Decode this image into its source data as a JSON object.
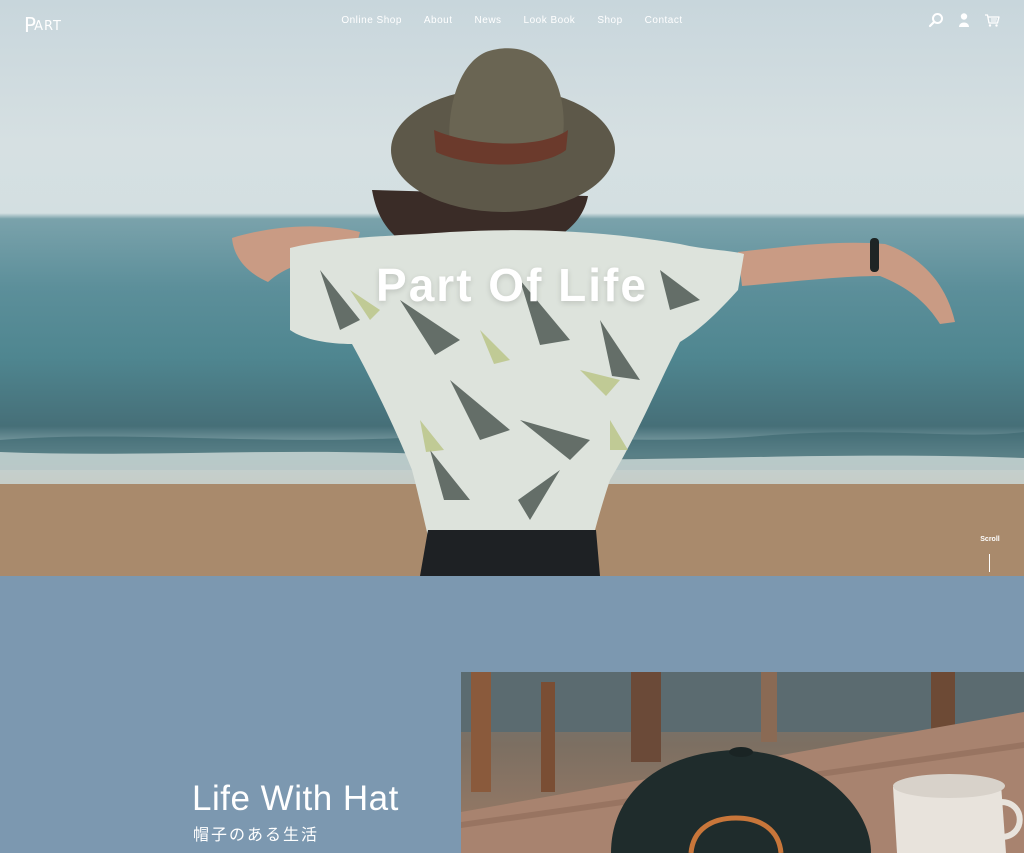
{
  "brand": {
    "logo_initial": "P",
    "logo_rest": "ART"
  },
  "nav": {
    "items": [
      {
        "label": "Online Shop"
      },
      {
        "label": "About"
      },
      {
        "label": "News"
      },
      {
        "label": "Look Book"
      },
      {
        "label": "Shop"
      },
      {
        "label": "Contact"
      }
    ],
    "icons": [
      "search-icon",
      "user-icon",
      "cart-icon"
    ]
  },
  "hero": {
    "title": "Part Of Life",
    "scroll_label": "Scroll"
  },
  "section": {
    "title": "Life With Hat",
    "subtitle": "帽子のある生活"
  },
  "colors": {
    "section_bg": "#7c98b0",
    "text": "#ffffff"
  }
}
